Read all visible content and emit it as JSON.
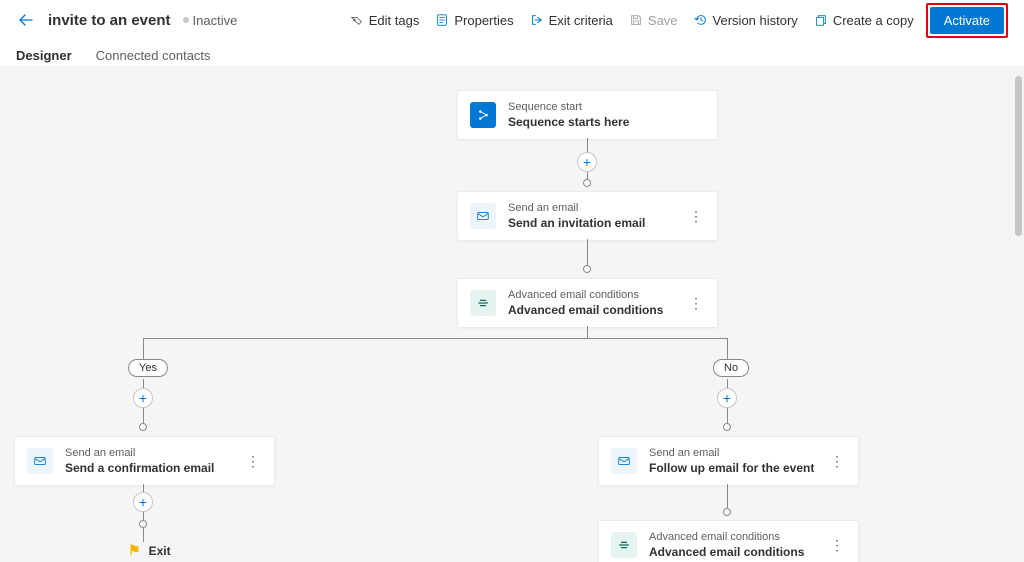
{
  "header": {
    "title": "invite to an event",
    "status": "Inactive",
    "commands": {
      "edit_tags": "Edit tags",
      "properties": "Properties",
      "exit_criteria": "Exit criteria",
      "save": "Save",
      "version_history": "Version history",
      "create_copy": "Create a copy",
      "activate": "Activate"
    }
  },
  "tabs": {
    "designer": "Designer",
    "connected": "Connected contacts"
  },
  "nodes": {
    "start": {
      "type": "Sequence start",
      "title": "Sequence starts here"
    },
    "invite": {
      "type": "Send an email",
      "title": "Send an invitation email"
    },
    "cond1": {
      "type": "Advanced email conditions",
      "title": "Advanced email conditions"
    },
    "yes": "Yes",
    "no": "No",
    "confirm": {
      "type": "Send an email",
      "title": "Send a confirmation email"
    },
    "followup": {
      "type": "Send an email",
      "title": "Follow up email for the event"
    },
    "cond2": {
      "type": "Advanced email conditions",
      "title": "Advanced email conditions"
    },
    "exit": "Exit"
  }
}
